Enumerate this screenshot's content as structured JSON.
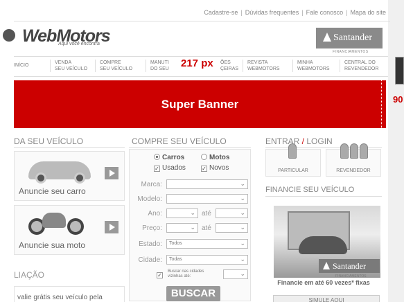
{
  "toplinks": [
    "Cadastre-se",
    "Dúvidas frequentes",
    "Fale conosco",
    "Mapa do site"
  ],
  "logo": {
    "name": "WebMotors",
    "tagline": "Aqui você encontra"
  },
  "sponsor": {
    "brand": "Santander",
    "sub": "FINANCIAMENTOS"
  },
  "nav": [
    {
      "line1": "INÍCIO",
      "line2": ""
    },
    {
      "line1": "VENDA",
      "line2": "SEU VEÍCULO"
    },
    {
      "line1": "COMPRE",
      "line2": "SEU VEÍCULO"
    },
    {
      "line1": "MANUTI",
      "line2": "DO SEU"
    },
    {
      "line1": "ÕES",
      "line2": "ÇEIRAS"
    },
    {
      "line1": "REVISTA",
      "line2": "WEBMOTORS"
    },
    {
      "line1": "MINHA",
      "line2": "WEBMOTORS"
    },
    {
      "line1": "CENTRAL DO",
      "line2": "REVENDEDOR"
    }
  ],
  "measure_label": "217 px",
  "measure_right": "90",
  "banner": {
    "label": "Super Banner"
  },
  "sell": {
    "title": "DA SEU VEÍCULO",
    "car_label": "Anuncie seu carro",
    "moto_label": "Anuncie sua moto"
  },
  "evaluation": {
    "title": "LIAÇÃO",
    "text": "valie grátis seu veículo pela"
  },
  "buy": {
    "title": "COMPRE SEU VEÍCULO",
    "radio_car": "Carros",
    "radio_moto": "Motos",
    "check_used": "Usados",
    "check_new": "Novos",
    "labels": {
      "marca": "Marca:",
      "modelo": "Modelo:",
      "ano": "Ano:",
      "preco": "Preço:",
      "estado": "Estado:",
      "cidade": "Cidade:"
    },
    "ate": "até",
    "estado_value": "Todos",
    "cidade_value": "Todas",
    "nearby": "Buscar nas cidades vizinhas até:",
    "search_button": "BUSCAR"
  },
  "login": {
    "title_prefix": "ENTRAR",
    "title_sep": " / ",
    "title_suffix": "LOGIN",
    "particular": "PARTICULAR",
    "revendedor": "REVENDEDOR"
  },
  "finance": {
    "title": "FINANCIE SEU VEÍCULO",
    "brand": "Santander",
    "sub": "FINANCIAMENTOS",
    "caption": "Financie em até 60 vezes* fixas",
    "simulate": "SIMULE AQUI"
  }
}
